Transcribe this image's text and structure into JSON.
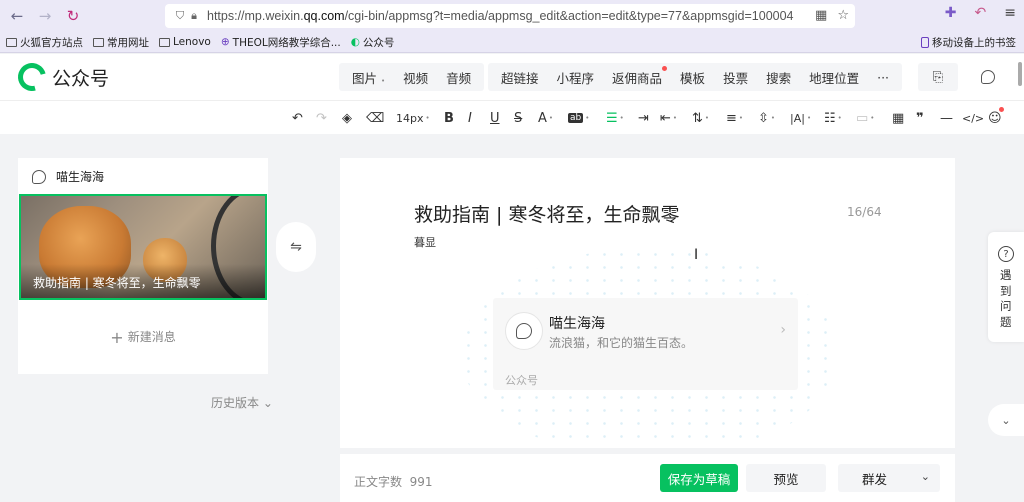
{
  "browser": {
    "url_prefix": "https://mp.weixin.",
    "url_domain": "qq.com",
    "url_rest": "/cgi-bin/appmsg?t=media/appmsg_edit&action=edit&type=77&appmsgid=100004",
    "bookmarks": [
      "火狐官方站点",
      "常用网址",
      "Lenovo",
      "THEOL网络教学综合...",
      "公众号"
    ],
    "mobile_bookmarks": "移动设备上的书签"
  },
  "header": {
    "logo_text": "公众号",
    "insert_media": [
      "图片",
      "视频",
      "音频"
    ],
    "insert_more": [
      "超链接",
      "小程序",
      "返佣商品",
      "模板",
      "投票",
      "搜索",
      "地理位置",
      "···"
    ]
  },
  "toolbar": {
    "font_size": "14px",
    "text_a": "A",
    "bg_ab": "ab",
    "letter_spacing": "|A|"
  },
  "left_panel": {
    "account_name": "喵生海海",
    "article_caption": "救助指南 | 寒冬将至，生命飘零",
    "new_message": "新建消息",
    "history_version": "历史版本"
  },
  "editor": {
    "title": "救助指南 | 寒冬将至，生命飘零",
    "title_count": "16/64",
    "author": "暮显",
    "card": {
      "name": "喵生海海",
      "desc": "流浪猫，和它的猫生百态。",
      "footer": "公众号"
    }
  },
  "bottom": {
    "word_count_label": "正文字数",
    "word_count_value": "991",
    "save_draft": "保存为草稿",
    "preview": "预览",
    "publish": "群发"
  },
  "help": {
    "text": "遇到问题"
  }
}
